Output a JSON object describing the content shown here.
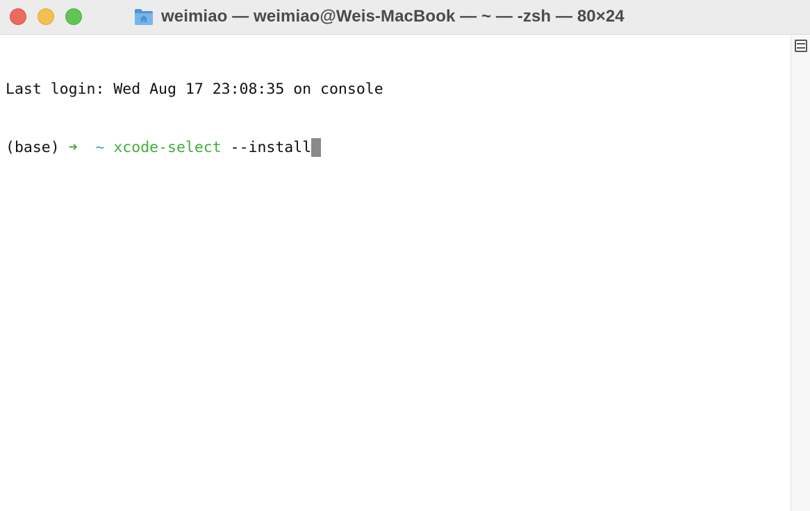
{
  "window": {
    "title": "weimiao — weimiao@Weis-MacBook — ~ — -zsh — 80×24",
    "title_icon": "home-folder-icon",
    "controls": {
      "close": "close-button",
      "minimize": "minimize-button",
      "zoom": "zoom-button"
    }
  },
  "terminal": {
    "lines": [
      {
        "text": "Last login: Wed Aug 17 23:08:35 on console"
      },
      {
        "prefix": "(base) ",
        "arrow": "➜",
        "tilde": "~",
        "command": "xcode-select",
        "args": " --install"
      }
    ],
    "colors": {
      "text": "#111111",
      "arrow": "#3fae3b",
      "tilde": "#37a6c8",
      "command": "#3fae3b",
      "cursor": "#8a8a8a"
    }
  },
  "scrollbar": {
    "split_icon": "split-pane-icon"
  }
}
